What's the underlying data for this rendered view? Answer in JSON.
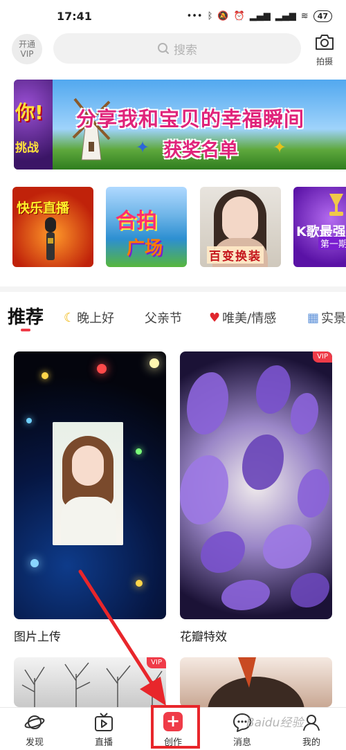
{
  "status_bar": {
    "time": "17:41",
    "battery": "47"
  },
  "header": {
    "vip_line1": "开通",
    "vip_line2": "VIP",
    "search_placeholder": "搜索",
    "camera_label": "拍摄"
  },
  "banner": {
    "side_text_1": "你!",
    "side_text_2": "挑战",
    "title": "分享我和宝贝的幸福瞬间",
    "subtitle": "获奖名单"
  },
  "categories": [
    {
      "label": "快乐直播"
    },
    {
      "label_1": "合拍",
      "label_2": "广场"
    },
    {
      "label": "百变换装"
    },
    {
      "label": "K歌最强",
      "sub": "第一期"
    }
  ],
  "tabs": [
    {
      "label": "推荐",
      "active": true
    },
    {
      "label": "晚上好",
      "icon": "moon-icon"
    },
    {
      "label": "父亲节"
    },
    {
      "label": "唯美/情感",
      "icon": "heart-icon"
    },
    {
      "label": "实景",
      "icon": "building-icon"
    }
  ],
  "feed": [
    {
      "title": "图片上传",
      "vip": false
    },
    {
      "title": "花瓣特效",
      "vip": true
    },
    {
      "title": "",
      "vip": true
    },
    {
      "title": "",
      "vip": false
    }
  ],
  "vip_tag": "VIP",
  "bottom_nav": [
    {
      "label": "发现",
      "icon": "planet-icon"
    },
    {
      "label": "直播",
      "icon": "tv-play-icon"
    },
    {
      "label": "创作",
      "icon": "plus-square-icon"
    },
    {
      "label": "消息",
      "icon": "chat-bubble-icon"
    },
    {
      "label": "我的",
      "icon": "profile-icon"
    }
  ],
  "watermark": "Baidu经验",
  "colors": {
    "accent": "#ef3b48",
    "annotation": "#e8262b",
    "search_bg": "#f1f1f1"
  }
}
